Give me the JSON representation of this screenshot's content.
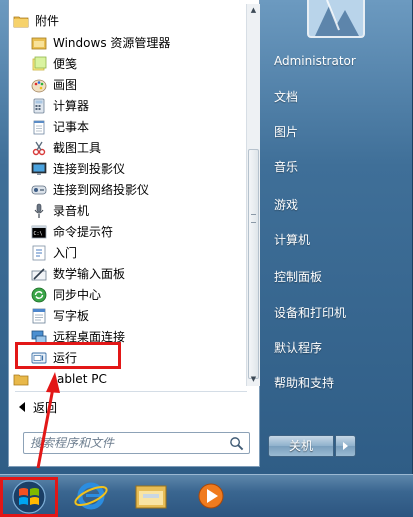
{
  "accessories_folder": "附件",
  "programs": [
    {
      "label": "Windows 资源管理器",
      "icon": "explorer-folder-icon"
    },
    {
      "label": "便笺",
      "icon": "sticky-notes-icon"
    },
    {
      "label": "画图",
      "icon": "paint-icon"
    },
    {
      "label": "计算器",
      "icon": "calculator-icon"
    },
    {
      "label": "记事本",
      "icon": "notepad-icon"
    },
    {
      "label": "截图工具",
      "icon": "snipping-tool-icon"
    },
    {
      "label": "连接到投影仪",
      "icon": "projector-icon"
    },
    {
      "label": "连接到网络投影仪",
      "icon": "network-projector-icon"
    },
    {
      "label": "录音机",
      "icon": "microphone-icon"
    },
    {
      "label": "命令提示符",
      "icon": "command-prompt-icon"
    },
    {
      "label": "入门",
      "icon": "getting-started-icon"
    },
    {
      "label": "数学输入面板",
      "icon": "math-input-icon"
    },
    {
      "label": "同步中心",
      "icon": "sync-center-icon"
    },
    {
      "label": "写字板",
      "icon": "wordpad-icon"
    },
    {
      "label": "远程桌面连接",
      "icon": "remote-desktop-icon"
    },
    {
      "label": "运行",
      "icon": "run-icon"
    }
  ],
  "tablet_folder": "ablet PC",
  "back_label": "返回",
  "search_placeholder": "搜索程序和文件",
  "right_pane": {
    "user": "Administrator",
    "items": [
      "文档",
      "图片",
      "音乐",
      "游戏",
      "计算机",
      "控制面板",
      "设备和打印机",
      "默认程序",
      "帮助和支持"
    ]
  },
  "shutdown_label": "关机",
  "colors": {
    "annotation": "#e21717",
    "accent": "#2f5d86"
  }
}
